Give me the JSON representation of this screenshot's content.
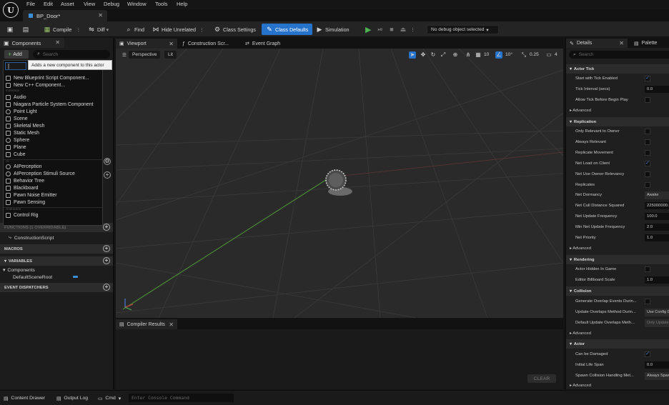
{
  "app": {
    "logo": "U"
  },
  "menu": [
    "File",
    "Edit",
    "Asset",
    "View",
    "Debug",
    "Window",
    "Tools",
    "Help"
  ],
  "document_tab": "BP_Door*",
  "toolbar": {
    "compile": "Compile",
    "diff": "Diff",
    "find": "Find",
    "hide_unrelated": "Hide Unrelated",
    "class_settings": "Class Settings",
    "class_defaults": "Class Defaults",
    "simulation": "Simulation",
    "debug_object": "No debug object selected"
  },
  "components": {
    "tab": "Components",
    "add_label": "Add",
    "search_placeholder": "Search",
    "tooltip": "Adds a new component to this actor",
    "dropdown_search": "|",
    "items": {
      "new_bp": "New Blueprint Script Component...",
      "new_cpp": "New C++ Component...",
      "audio": "Audio",
      "niagara": "Niagara Particle System Component",
      "point_light": "Point Light",
      "scene": "Scene",
      "skeletal_mesh": "Skeletal Mesh",
      "static_mesh": "Static Mesh",
      "sphere": "Sphere",
      "plane": "Plane",
      "cube": "Cube",
      "ai_perception": "AIPerception",
      "ai_stimuli": "AIPerception Stimuli Source",
      "behavior_tree": "Behavior Tree",
      "blackboard": "Blackboard",
      "pawn_noise": "Pawn Noise Emitter",
      "pawn_sensing": "Pawn Sensing",
      "control_rig": "Control Rig"
    },
    "categories": {
      "common": "Common",
      "ai": "AI",
      "animation": "Animation"
    }
  },
  "my_blueprint": {
    "functions_header": "FUNCTIONS (1 OVERRIDABLE)",
    "construction_script": "ConstructionScript",
    "macros": "MACROS",
    "variables": "VARIABLES",
    "components_group": "Components",
    "default_scene_root": "DefaultSceneRoot",
    "event_dispatchers": "EVENT DISPATCHERS"
  },
  "center_tabs": {
    "viewport": "Viewport",
    "construction": "Construction Scr...",
    "event_graph": "Event Graph"
  },
  "viewport": {
    "perspective": "Perspective",
    "lit": "Lit",
    "grid_size": "10",
    "rot_snap": "10°",
    "scale_snap": "0.25",
    "cam_speed": "4"
  },
  "compiler": {
    "tab": "Compiler Results",
    "clear": "CLEAR"
  },
  "details": {
    "tab": "Details",
    "palette_tab": "Palette",
    "search_placeholder": "Search",
    "actor_tick": "Actor Tick",
    "start_with_tick": "Start with Tick Enabled",
    "tick_interval": "Tick Interval (secs)",
    "tick_interval_val": "0.0",
    "allow_tick_paused": "Allow Tick Before Begin Play",
    "advanced": "Advanced",
    "replication": "Replication",
    "only_relevant_owner": "Only Relevant to Owner",
    "always_relevant": "Always Relevant",
    "replicate_movement": "Replicate Movement",
    "net_load_client": "Net Load on Client",
    "net_use_owner_relevancy": "Net Use Owner Relevancy",
    "replicates": "Replicates",
    "net_dormancy": "Net Dormancy",
    "net_dormancy_val": "Awake",
    "net_cull_distance": "Net Cull Distance Squared",
    "net_cull_distance_val": "225000000.0",
    "net_update_freq": "Net Update Frequency",
    "net_update_freq_val": "100.0",
    "min_net_update_freq": "Min Net Update Frequency",
    "min_net_update_freq_val": "2.0",
    "net_priority": "Net Priority",
    "net_priority_val": "1.0",
    "rendering": "Rendering",
    "actor_hidden": "Actor Hidden In Game",
    "billboard_scale": "Editor Billboard Scale",
    "billboard_scale_val": "1.0",
    "collision": "Collision",
    "gen_overlap": "Generate Overlap Events Durin...",
    "update_overlaps": "Update Overlaps Method Durin...",
    "update_overlaps_val": "Use Config D...",
    "default_update_overlaps": "Default Update Overlaps Meth...",
    "default_update_overlaps_val": "Only Update ...",
    "actor": "Actor",
    "can_be_damaged": "Can be Damaged",
    "initial_life_span": "Initial Life Span",
    "initial_life_span_val": "0.0",
    "spawn_collision": "Spawn Collision Handling Met...",
    "spawn_collision_val": "Always Spawn..."
  },
  "bottombar": {
    "content_drawer": "Content Drawer",
    "output_log": "Output Log",
    "cmd": "Cmd",
    "console_placeholder": "Enter Console Command"
  },
  "colors": {
    "accent": "#2673cc",
    "play": "#4caf50",
    "bg": "#151515"
  }
}
